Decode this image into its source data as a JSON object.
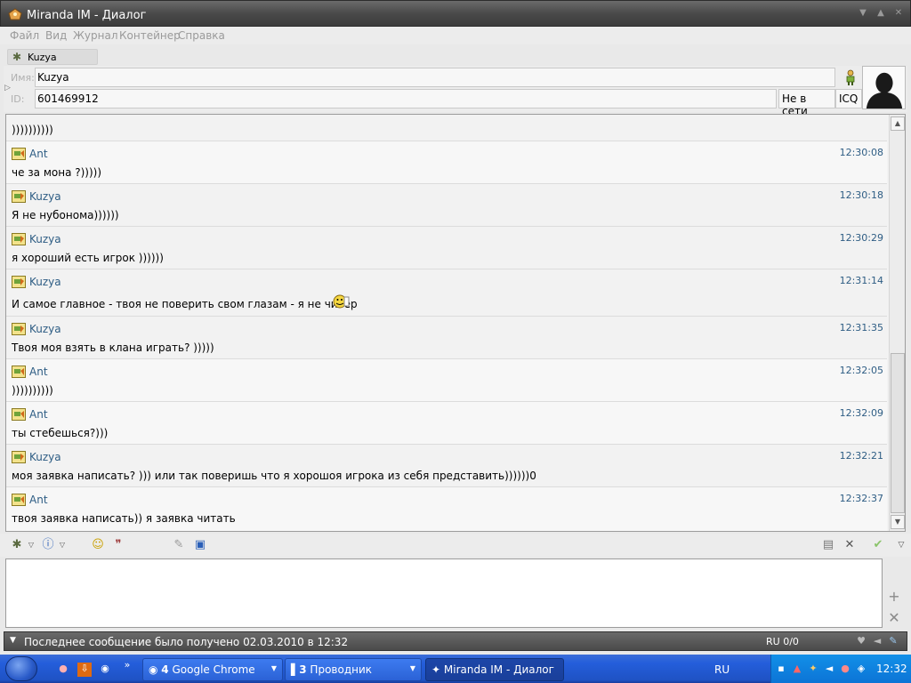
{
  "window": {
    "title": "Miranda IM - Диалог",
    "buttons": [
      "▼",
      "▲",
      "✕"
    ]
  },
  "menu": [
    "Файл",
    "Вид",
    "Журнал",
    "Контейнер",
    "Справка"
  ],
  "tab": {
    "name": "Kuzya"
  },
  "info": {
    "name_label": "Имя:",
    "name_value": "Kuzya",
    "id_label": "ID:",
    "id_value": "601469912",
    "status": "Не в сети",
    "protocol": "ICQ"
  },
  "messages": [
    {
      "nick": "",
      "time": "",
      "text": "))))))))))"
    },
    {
      "nick": "Ant",
      "time": "12:30:08",
      "text": "че за мона ?)))))"
    },
    {
      "nick": "Kuzya",
      "time": "12:30:18",
      "text": "Я не нубонома))))))"
    },
    {
      "nick": "Kuzya",
      "time": "12:30:29",
      "text": "я хороший есть игрок ))))))"
    },
    {
      "nick": "Kuzya",
      "time": "12:31:14",
      "text": "И самое главное - твоя не поверить свом глазам - я не читер"
    },
    {
      "nick": "Kuzya",
      "time": "12:31:35",
      "text": "Твоя моя взять в клана играть? )))))"
    },
    {
      "nick": "Ant",
      "time": "12:32:05",
      "text": "))))))))))"
    },
    {
      "nick": "Ant",
      "time": "12:32:09",
      "text": "ты стебешься?)))"
    },
    {
      "nick": "Kuzya",
      "time": "12:32:21",
      "text": "моя заявка написать? ))) или так поверишь что я хорошоя игрока из себя представить))))))0"
    },
    {
      "nick": "Ant",
      "time": "12:32:37",
      "text": "твоя заявка написать)) я заявка читать"
    }
  ],
  "input": {
    "value": ""
  },
  "statusbar": {
    "last_message": "Последнее сообщение было получено 02.03.2010 в 12:32",
    "lang": "RU 0/0"
  },
  "taskbar": {
    "tasks": [
      {
        "count": "4",
        "label": "Google Chrome"
      },
      {
        "count": "3",
        "label": "Проводник"
      },
      {
        "count": "",
        "label": "Miranda IM - Диалог"
      }
    ],
    "quicklaunch_more": "»",
    "kbd_lang": "RU",
    "clock": "12:32"
  },
  "colors": {
    "nick": "#2e5d84",
    "titlebar": "#4a4a4a",
    "taskbar": "#245edb"
  }
}
